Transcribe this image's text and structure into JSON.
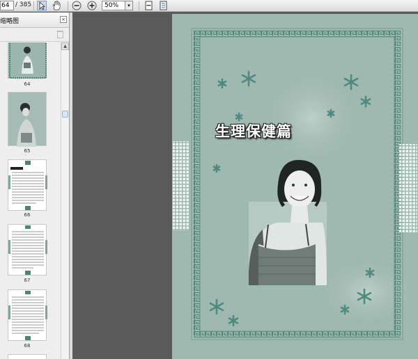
{
  "toolbar": {
    "current_page": "64",
    "total_pages": "/ 385",
    "zoom": "50%",
    "zoom_dropdown": "▾"
  },
  "sidebar": {
    "panel_title": "缩略图",
    "close_glyph": "×",
    "thumbnails": [
      {
        "label": "64"
      },
      {
        "label": "65"
      },
      {
        "label": "66"
      },
      {
        "label": "67"
      },
      {
        "label": "68"
      }
    ]
  },
  "page": {
    "title": "生理保健篇"
  },
  "colors": {
    "page_bg": "#9fb8b0",
    "border_pattern": "#4e8378",
    "star": "#4f8a80",
    "app_bg": "#5a5a5a"
  },
  "icons": [
    "select-arrow-icon",
    "hand-tool-icon",
    "zoom-out-icon",
    "zoom-in-icon",
    "fit-page-icon",
    "fit-width-icon",
    "trash-icon",
    "scroll-up-icon"
  ]
}
